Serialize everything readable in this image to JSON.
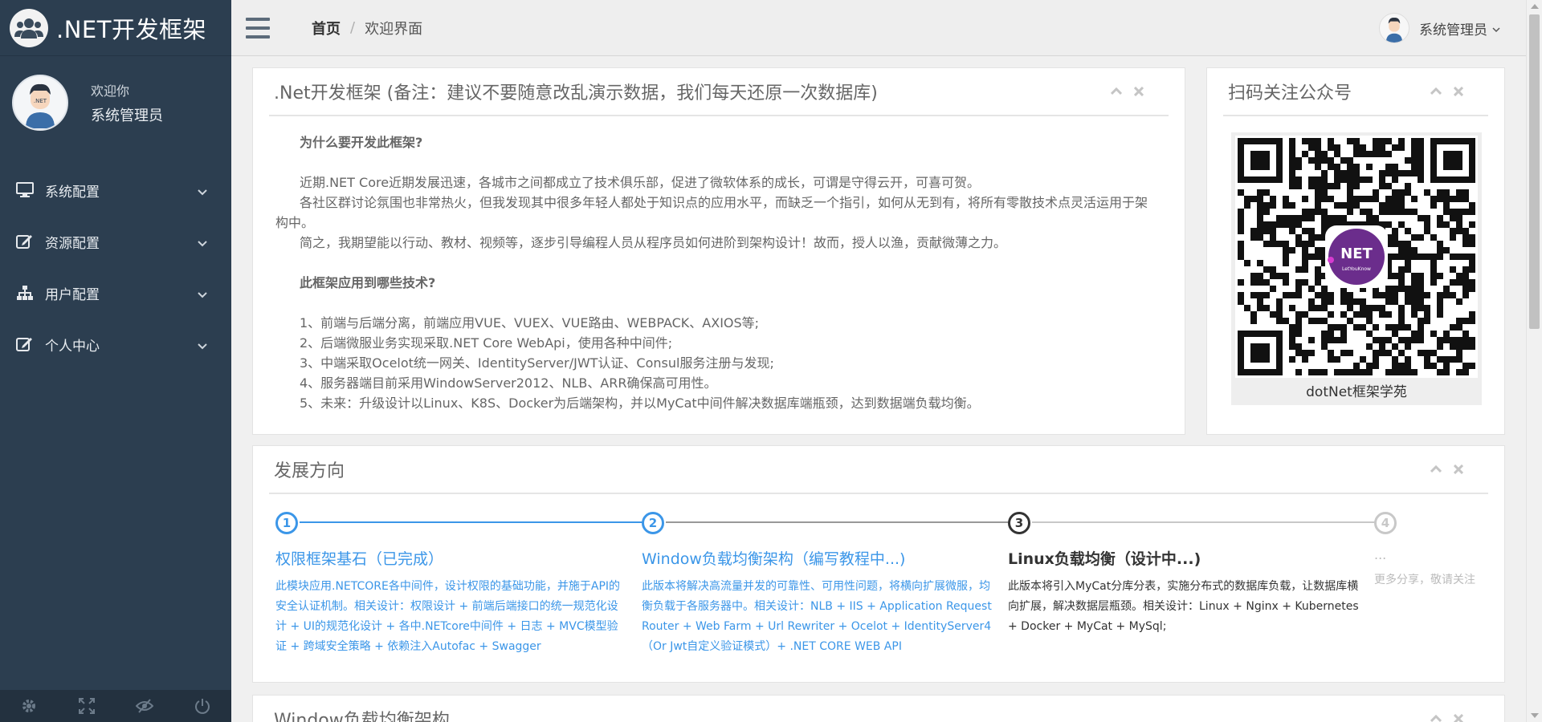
{
  "brand": {
    "title": ".NET开发框架"
  },
  "profile": {
    "welcome": "欢迎你",
    "name": "系统管理员"
  },
  "menu": [
    {
      "label": "系统配置",
      "icon": "monitor-icon"
    },
    {
      "label": "资源配置",
      "icon": "edit-icon"
    },
    {
      "label": "用户配置",
      "icon": "sitemap-icon"
    },
    {
      "label": "个人中心",
      "icon": "edit-icon"
    }
  ],
  "footer_icons": [
    "gear-icon",
    "expand-icon",
    "eye-slash-icon",
    "power-icon"
  ],
  "breadcrumb": {
    "home": "首页",
    "separator": "/",
    "current": "欢迎界面"
  },
  "user": {
    "name": "系统管理员"
  },
  "intro": {
    "title": ".Net开发框架 (备注：建议不要随意改乱演示数据，我们每天还原一次数据库)",
    "q1": "为什么要开发此框架?",
    "p1": "近期.NET Core近期发展迅速，各城市之间都成立了技术俱乐部，促进了微软体系的成长，可谓是守得云开，可喜可贺。",
    "p2": "各社区群讨论氛围也非常热火，但我发现其中很多年轻人都处于知识点的应用水平，而缺乏一个指引，如何从无到有，将所有零散技术点灵活运用于架构中。",
    "p3": "简之，我期望能以行动、教材、视频等，逐步引导编程人员从程序员如何进阶到架构设计！故而，授人以渔，贡献微薄之力。",
    "q2": "此框架应用到哪些技术?",
    "items": [
      "1、前端与后端分离，前端应用VUE、VUEX、VUE路由、WEBPACK、AXIOS等;",
      "2、后端微服业务实现采取.NET Core WebApi，使用各种中间件;",
      "3、中端采取Ocelot统一网关、IdentityServer/JWT认证、Consul服务注册与发现;",
      "4、服务器端目前采用WindowServer2012、NLB、ARR确保高可用性。",
      "5、未来：升级设计以Linux、K8S、Docker为后端架构，并以MyCat中间件解决数据库端瓶颈，达到数据端负载均衡。"
    ]
  },
  "qr": {
    "title": "扫码关注公众号",
    "caption": "dotNet框架学苑",
    "badge_main": "NET",
    "badge_sub": "LetYouKnow"
  },
  "roadmap": {
    "title": "发展方向",
    "steps": [
      {
        "num": "1",
        "title": "权限框架基石（已完成）",
        "desc": "此模块应用.NETCORE各中间件，设计权限的基础功能，并施于API的安全认证机制。相关设计：权限设计 + 前端后端接口的统一规范化设计 + UI的规范化设计 + 各中.NETcore中间件 + 日志 + MVC模型验证 + 跨域安全策略 + 依赖注入Autofac + Swagger"
      },
      {
        "num": "2",
        "title": "Window负载均衡架构（编写教程中...)",
        "desc": "此版本将解决高流量并发的可靠性、可用性问题，将横向扩展微服，均衡负载于各服务器中。相关设计：NLB + IIS + Application Request Router + Web Farm + Url Rewriter + Ocelot + IdentityServer4（Or Jwt自定义验证模式）+ .NET CORE WEB API"
      },
      {
        "num": "3",
        "title": "Linux负载均衡（设计中...)",
        "desc": "此版本将引入MyCat分库分表，实施分布式的数据库负载，让数据库横向扩展，解决数据层瓶颈。相关设计：Linux + Nginx + Kubernetes + Docker + MyCat + MySql;"
      },
      {
        "num": "4",
        "title": "...",
        "desc": "更多分享，敬请关注"
      }
    ]
  },
  "panel3": {
    "title": "Window负载均衡架构"
  },
  "colors": {
    "sidebar": "#2c3e50",
    "accent": "#3b96e8",
    "qr_badge": "#6b2d8c"
  }
}
